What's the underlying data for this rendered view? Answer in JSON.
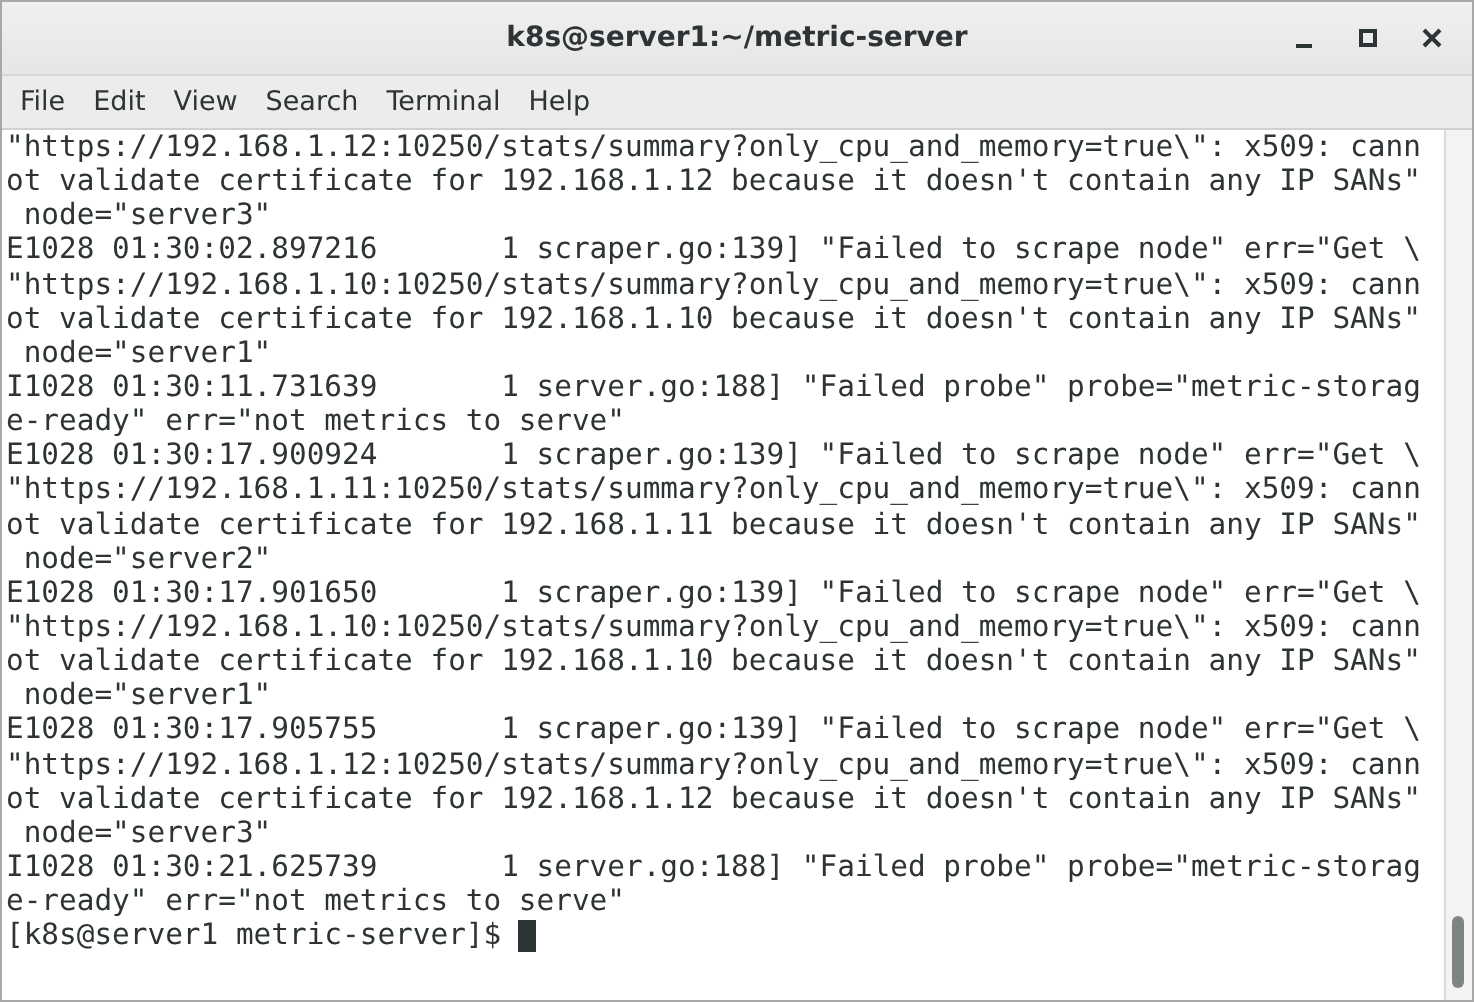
{
  "window": {
    "title": "k8s@server1:~/metric-server"
  },
  "menu": [
    "File",
    "Edit",
    "View",
    "Search",
    "Terminal",
    "Help"
  ],
  "terminal": {
    "lines": [
      "\"https://192.168.1.12:10250/stats/summary?only_cpu_and_memory=true\\\": x509: cann",
      "ot validate certificate for 192.168.1.12 because it doesn't contain any IP SANs\"",
      " node=\"server3\"",
      "E1028 01:30:02.897216       1 scraper.go:139] \"Failed to scrape node\" err=\"Get \\",
      "\"https://192.168.1.10:10250/stats/summary?only_cpu_and_memory=true\\\": x509: cann",
      "ot validate certificate for 192.168.1.10 because it doesn't contain any IP SANs\"",
      " node=\"server1\"",
      "I1028 01:30:11.731639       1 server.go:188] \"Failed probe\" probe=\"metric-storag",
      "e-ready\" err=\"not metrics to serve\"",
      "E1028 01:30:17.900924       1 scraper.go:139] \"Failed to scrape node\" err=\"Get \\",
      "\"https://192.168.1.11:10250/stats/summary?only_cpu_and_memory=true\\\": x509: cann",
      "ot validate certificate for 192.168.1.11 because it doesn't contain any IP SANs\"",
      " node=\"server2\"",
      "E1028 01:30:17.901650       1 scraper.go:139] \"Failed to scrape node\" err=\"Get \\",
      "\"https://192.168.1.10:10250/stats/summary?only_cpu_and_memory=true\\\": x509: cann",
      "ot validate certificate for 192.168.1.10 because it doesn't contain any IP SANs\"",
      " node=\"server1\"",
      "E1028 01:30:17.905755       1 scraper.go:139] \"Failed to scrape node\" err=\"Get \\",
      "\"https://192.168.1.12:10250/stats/summary?only_cpu_and_memory=true\\\": x509: cann",
      "ot validate certificate for 192.168.1.12 because it doesn't contain any IP SANs\"",
      " node=\"server3\"",
      "I1028 01:30:21.625739       1 server.go:188] \"Failed probe\" probe=\"metric-storag",
      "e-ready\" err=\"not metrics to serve\""
    ],
    "prompt": "[k8s@server1 metric-server]$ "
  }
}
